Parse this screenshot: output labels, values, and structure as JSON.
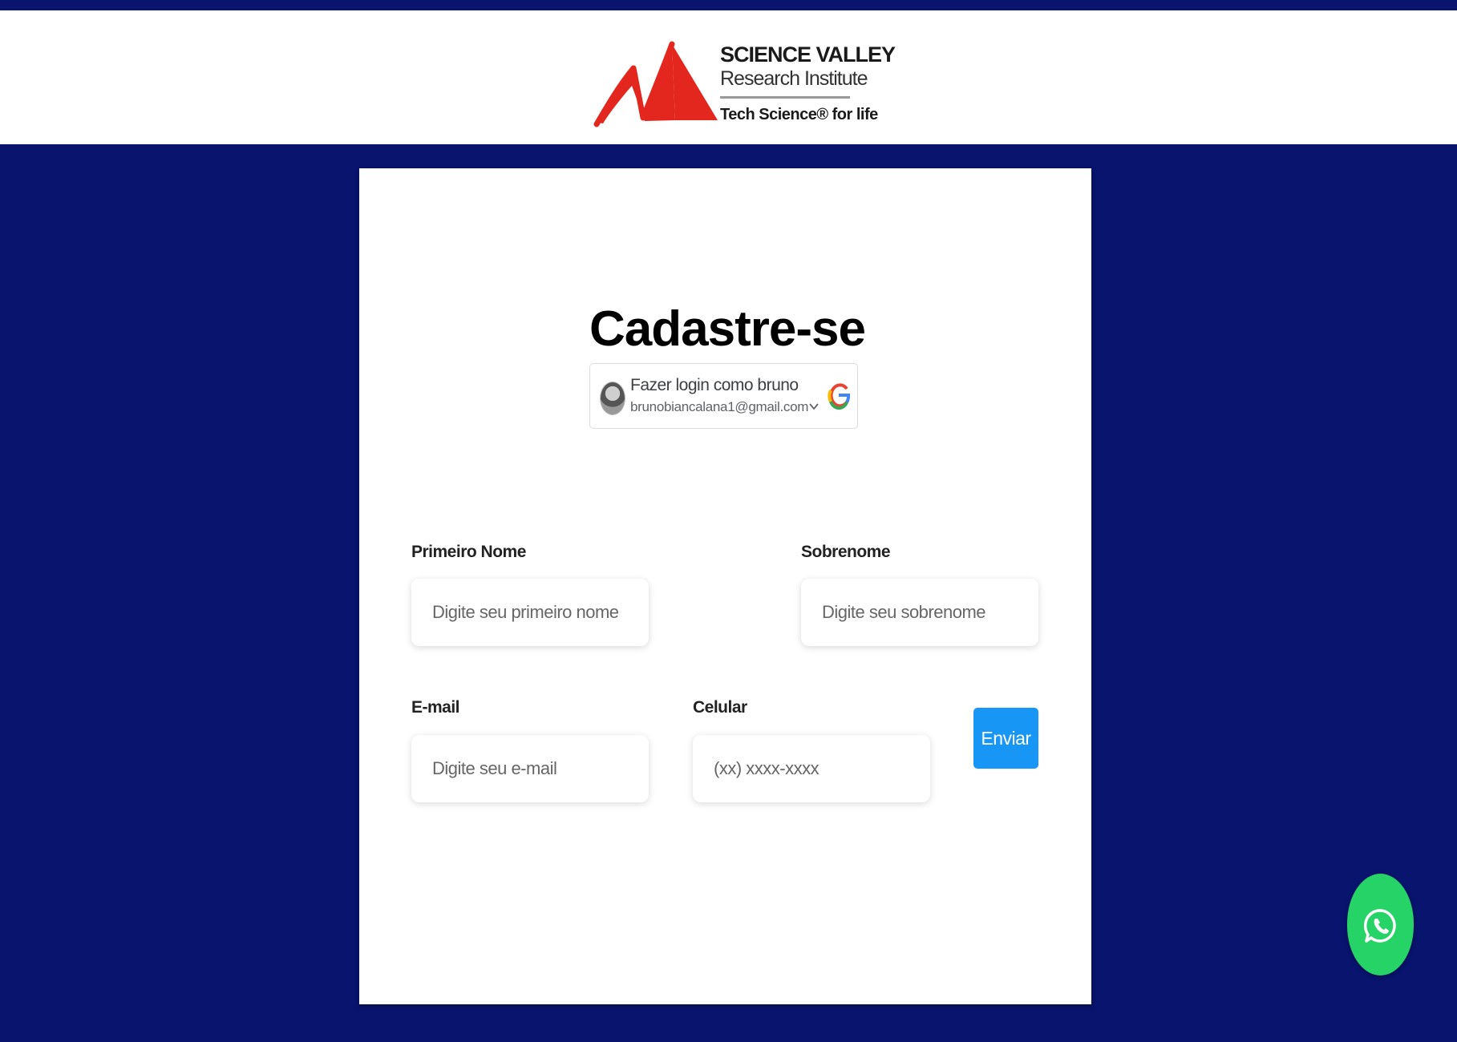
{
  "header": {
    "logo": {
      "name": "SCIENCE VALLEY",
      "subtitle": "Research Institute",
      "tagline": "Tech Science® for life",
      "mark_color": "#e3271f"
    }
  },
  "form": {
    "title": "Cadastre-se",
    "google": {
      "name_line": "Fazer login como bruno",
      "email": "brunobiancalana1@gmail.com",
      "avatar_icon": "user-avatar",
      "chevron_icon": "chevron-down-icon",
      "brand_icon": "google-icon"
    },
    "fields": {
      "first_name": {
        "label": "Primeiro Nome",
        "placeholder": "Digite seu primeiro nome",
        "value": ""
      },
      "last_name": {
        "label": "Sobrenome",
        "placeholder": "Digite seu sobrenome",
        "value": ""
      },
      "email": {
        "label": "E-mail",
        "placeholder": "Digite seu e-mail",
        "value": ""
      },
      "phone": {
        "label": "Celular",
        "placeholder": "(xx) xxxx-xxxx",
        "value": ""
      }
    },
    "submit_label": "Enviar"
  },
  "floating": {
    "whatsapp_icon": "whatsapp-icon"
  },
  "colors": {
    "page_background": "#08146e",
    "header_background": "#ffffff",
    "submit_button": "#1796f5",
    "whatsapp": "#25d366"
  }
}
